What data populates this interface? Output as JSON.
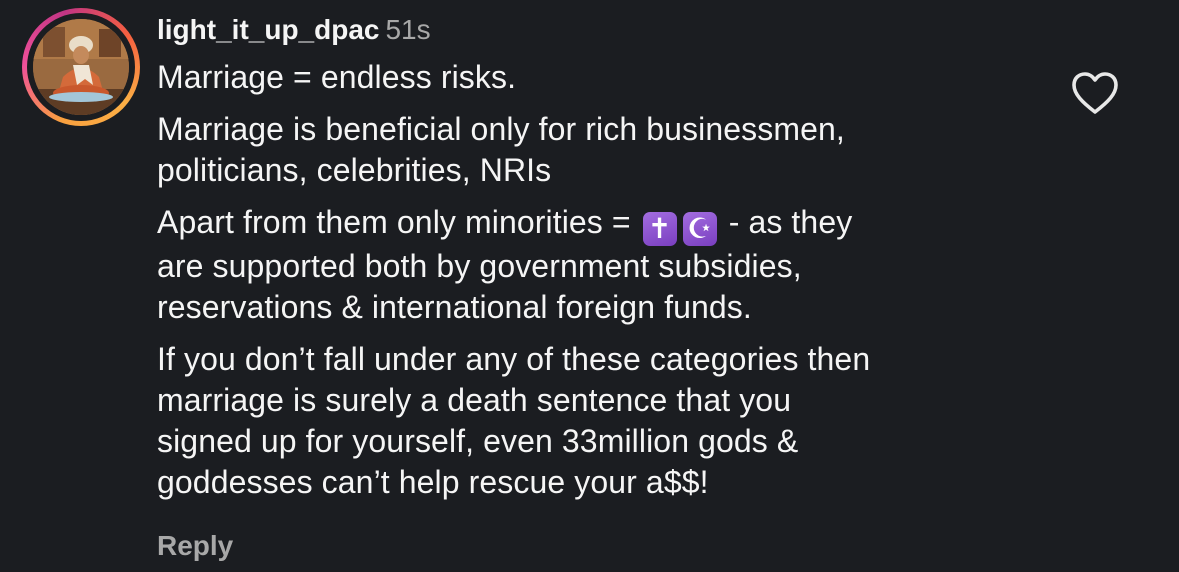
{
  "comment": {
    "username": "light_it_up_dpac",
    "timestamp": "51s",
    "paragraphs": {
      "p1": "Marriage = endless risks.",
      "p2_line1": "Marriage is beneficial only for rich businessmen,",
      "p2_line2": "politicians, celebrities, NRIs",
      "p3_before": "Apart from them only minorities =",
      "p3_emoji1": "✝",
      "p3_emoji2": "☪",
      "p3_after": " - as they",
      "p3_line2": "are supported both by government subsidies,",
      "p3_line3": "reservations & international foreign funds.",
      "p4_line1": "If you don’t fall under any of these categories then",
      "p4_line2": "marriage is surely a death sentence that you",
      "p4_line3": "signed up for yourself, even 33million gods &",
      "p4_line4": "goddesses can’t help rescue your a$$!"
    },
    "reply_label": "Reply",
    "like_icon": "heart-outline-icon",
    "avatar_icon": "profile-photo",
    "colors": {
      "background": "#1b1d21",
      "text": "#f5f5f5",
      "muted": "#a8a8a8",
      "emoji_purple": "#8e4fd0"
    }
  }
}
